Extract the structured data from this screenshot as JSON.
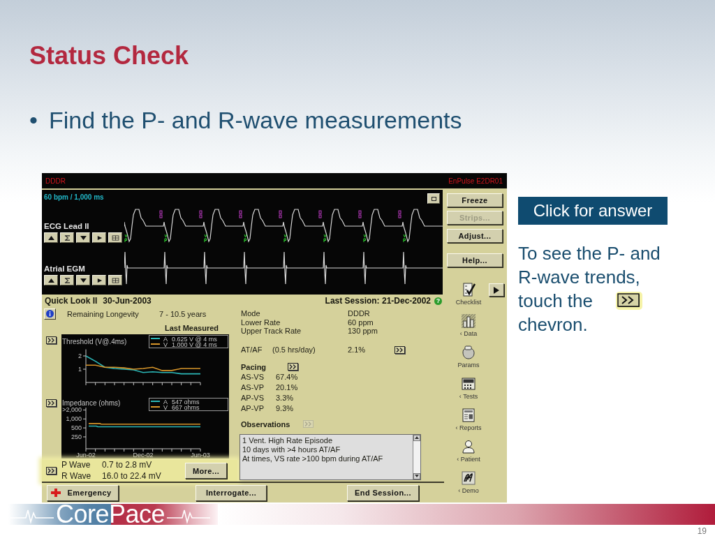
{
  "slide": {
    "title": "Status Check",
    "bullets": [
      {
        "marker": "•",
        "text": "Find the P- and R-wave measurements"
      }
    ],
    "logo": "CorePace",
    "page_number": "19"
  },
  "programmer": {
    "header": {
      "mode": "DDDR",
      "device": "EnPulse E2DR01"
    },
    "ecg": {
      "scale": "60 bpm / 1,000 ms",
      "channels": [
        {
          "label": "ECG Lead II",
          "kind": "ecg"
        },
        {
          "label": "Atrial EGM",
          "kind": "egm"
        }
      ]
    },
    "quick_look": {
      "title": "Quick Look II",
      "date": "30-Jun-2003",
      "last_session": "Last Session: 21-Dec-2002",
      "help_glyph": "?",
      "longevity": {
        "label": "Remaining Longevity",
        "value": "7 - 10.5 years"
      },
      "last_measured": "Last Measured",
      "trends": [
        {
          "readings": [
            "0.625 V @ 4 ms",
            "1.000 V @ 4 ms"
          ],
          "chart_data": {
            "type": "line",
            "title": "Threshold (V@.4ms)",
            "legend": "top right",
            "categories": [
              null,
              null,
              null,
              null,
              null,
              null,
              null,
              null,
              null,
              null,
              null,
              null,
              null
            ],
            "series": [
              {
                "name": "A",
                "color": "#2bb8b8",
                "values": [
                  2.0,
                  1.6,
                  1.15,
                  1.05,
                  1.0,
                  0.95,
                  0.75,
                  0.8,
                  0.75,
                  0.75,
                  0.65,
                  0.65,
                  0.65
                ]
              },
              {
                "name": "V",
                "color": "#d8962a",
                "values": [
                  1.3,
                  1.3,
                  1.15,
                  1.15,
                  1.1,
                  1.0,
                  1.05,
                  1.15,
                  0.9,
                  0.9,
                  1.05,
                  1.05,
                  1.05
                ]
              }
            ],
            "ylim": [
              0,
              2.5
            ],
            "yticks": [
              1,
              2
            ]
          }
        },
        {
          "readings": [
            "547 ohms",
            "667 ohms"
          ],
          "title": "Impedance (ohms)",
          "series": [
            {
              "name": "A",
              "color": "#2bb8b8"
            },
            {
              "name": "V",
              "color": "#d8962a"
            }
          ],
          "y_labels": [
            ">2,000",
            "1,000",
            "500",
            "250"
          ],
          "x_labels": [
            "Jun-02",
            "Dec-02",
            "Jun-03"
          ]
        }
      ],
      "waves": {
        "highlighted": true,
        "rows": [
          {
            "label": "P Wave",
            "value": "0.7 to 2.8 mV"
          },
          {
            "label": "R Wave",
            "value": "16.0 to 22.4 mV"
          }
        ],
        "more_button": "More..."
      },
      "settings": [
        {
          "label": "Mode",
          "value": "DDDR"
        },
        {
          "label": "Lower Rate",
          "value": "60 ppm"
        },
        {
          "label": "Upper Track Rate",
          "value": "130 ppm"
        }
      ],
      "at_af": {
        "label": "AT/AF",
        "detail": "(0.5 hrs/day)",
        "value": "2.1%"
      },
      "pacing": {
        "title": "Pacing",
        "rows": [
          {
            "label": "AS-VS",
            "value": "67.4%"
          },
          {
            "label": "AS-VP",
            "value": "20.1%"
          },
          {
            "label": "AP-VS",
            "value": "3.3%"
          },
          {
            "label": "AP-VP",
            "value": "9.3%"
          }
        ]
      },
      "observations": {
        "title": "Observations",
        "chevron_disabled": true,
        "lines": [
          "1 Vent. High Rate Episode",
          "10 days with >4 hours AT/AF",
          "At times, VS rate >100 bpm during AT/AF"
        ]
      }
    },
    "side_buttons": [
      {
        "label": "Freeze",
        "disabled": false
      },
      {
        "label": "Strips...",
        "disabled": true
      },
      {
        "label": "Adjust...",
        "disabled": false
      },
      {
        "label": "Help...",
        "disabled": false
      }
    ],
    "nav": [
      {
        "label": "Checklist",
        "kind": "checklist"
      },
      {
        "label": "‹ Data",
        "kind": "data"
      },
      {
        "label": "Params",
        "kind": "params"
      },
      {
        "label": "‹ Tests",
        "kind": "tests"
      },
      {
        "label": "‹ Reports",
        "kind": "reports"
      },
      {
        "label": "‹ Patient",
        "kind": "patient"
      },
      {
        "label": "‹ Demo",
        "kind": "demo"
      }
    ],
    "bottom_buttons": [
      {
        "label": "Emergency",
        "kind": "emergency"
      },
      {
        "label": "Interrogate...",
        "kind": "plain"
      },
      {
        "label": "End Session...",
        "kind": "plain"
      }
    ]
  },
  "answer_button": "Click for answer",
  "hint": {
    "lead": "To see the P- and R-wave trends,",
    "before_icon": "touch the",
    "after_icon": "chevron."
  }
}
